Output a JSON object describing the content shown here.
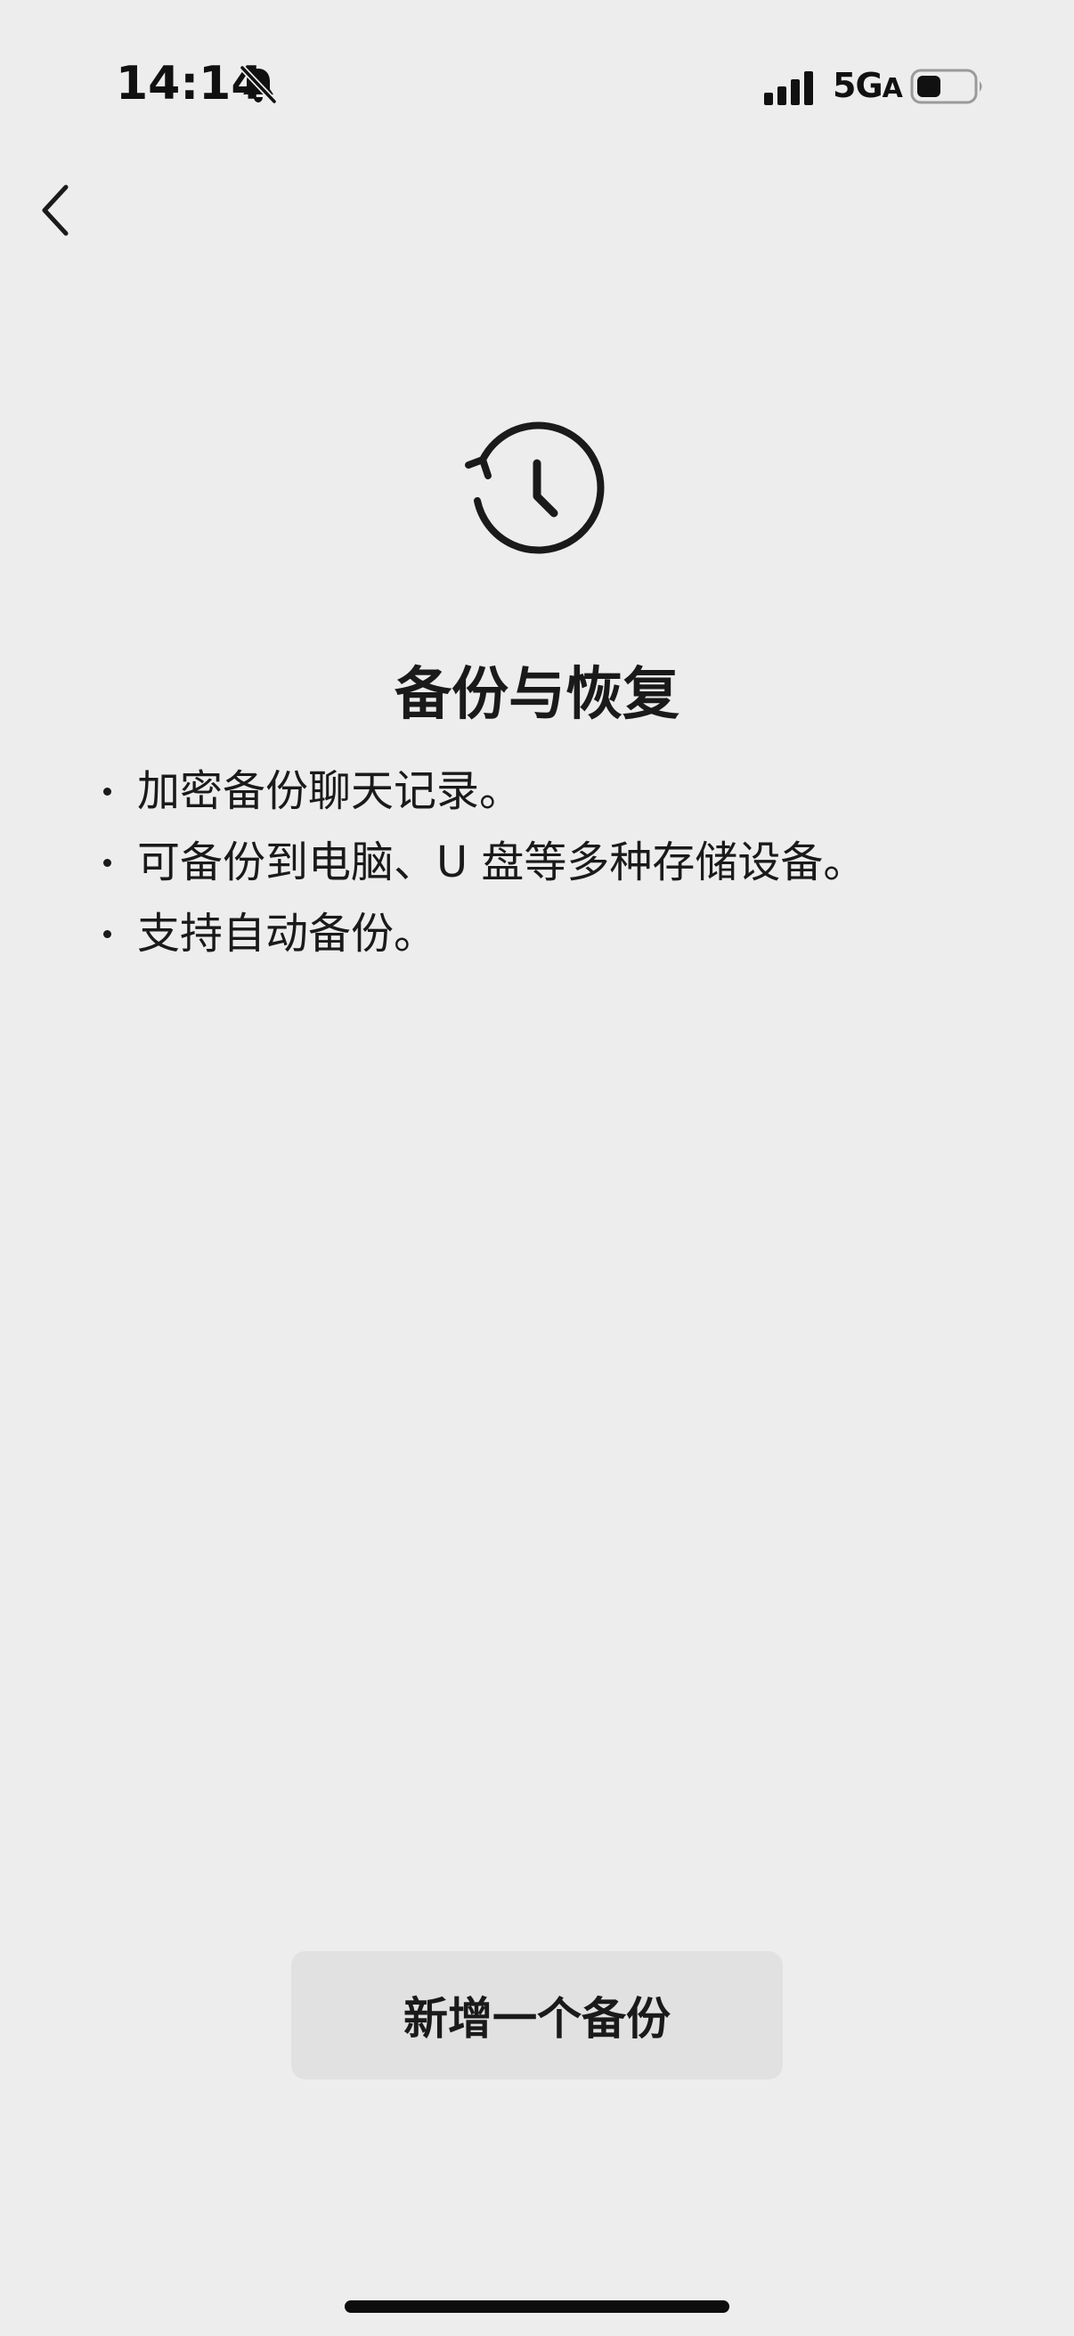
{
  "status_bar": {
    "time": "14:14",
    "network": "5G",
    "network_suffix": "A",
    "icons": [
      "bell-muted-icon",
      "signal-icon",
      "battery-icon"
    ]
  },
  "nav": {
    "back_icon": "chevron-left-icon"
  },
  "main": {
    "icon": "history-icon",
    "title": "备份与恢复",
    "features": [
      "加密备份聊天记录。",
      "可备份到电脑、U 盘等多种存储设备。",
      "支持自动备份。"
    ]
  },
  "actions": {
    "add_backup_label": "新增一个备份"
  },
  "colors": {
    "background": "#ededed",
    "text": "#1a1a1a",
    "button_bg": "#e1e1e1"
  }
}
